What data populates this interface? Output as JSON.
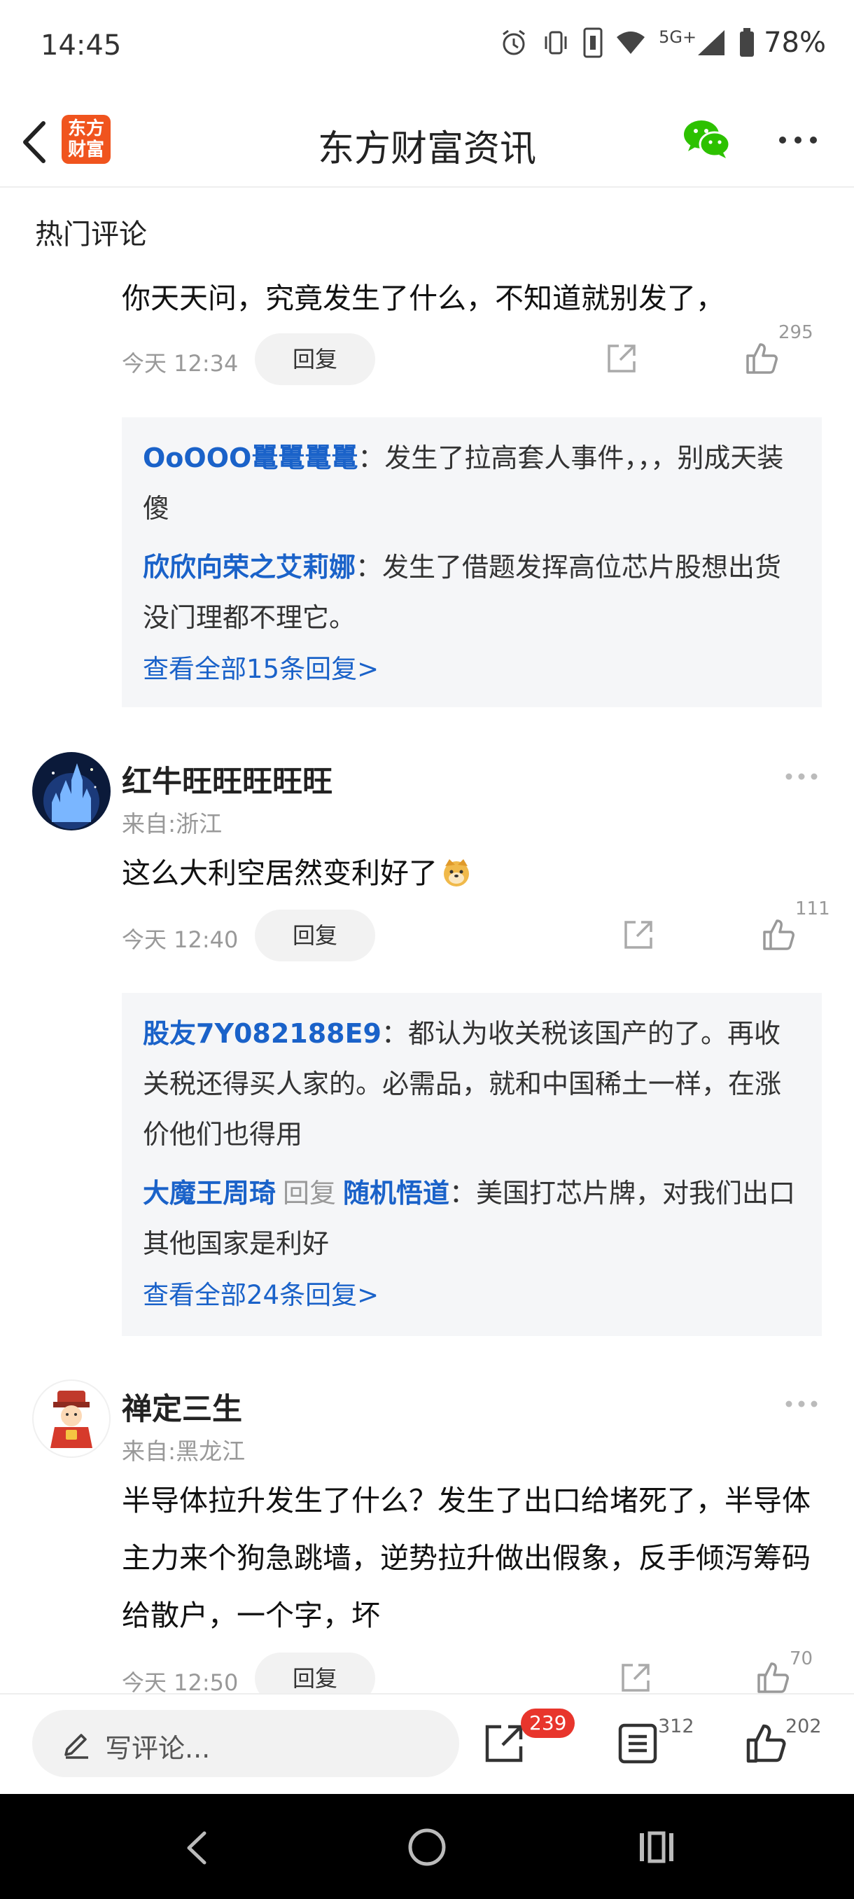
{
  "status_bar": {
    "time": "14:45",
    "network": "5G+",
    "battery": "78%"
  },
  "header": {
    "title": "东方财富资讯",
    "logo_text": "东方财富"
  },
  "section_title": "热门评论",
  "comments": [
    {
      "text": "你天天问，究竟发生了什么，不知道就别发了，",
      "time": "今天 12:34",
      "reply_label": "回复",
      "likes": "295",
      "replies": [
        {
          "user": "OoOOO鼍鼍鼍鼍",
          "text": "：发生了拉高套人事件，，，别成天装傻"
        },
        {
          "user": "欣欣向荣之艾莉娜",
          "text": "：发生了借题发挥高位芯片股想出货没门理都不理它。"
        }
      ],
      "view_all": "查看全部15条回复>"
    },
    {
      "user": "红牛旺旺旺旺旺",
      "location": "来自:浙江",
      "text": "这么大利空居然变利好了",
      "time": "今天 12:40",
      "reply_label": "回复",
      "likes": "111",
      "replies": [
        {
          "user": "股友7Y082188E9",
          "text": "：都认为收关税该国产的了。再收关税还得买人家的。必需品，就和中国稀土一样，在涨价他们也得用"
        },
        {
          "user": "大魔王周琦",
          "verb": "回复",
          "target": "随机悟道",
          "text": "：美国打芯片牌，对我们出口其他国家是利好"
        }
      ],
      "view_all": "查看全部24条回复>"
    },
    {
      "user": "禅定三生",
      "location": "来自:黑龙江",
      "text": "半导体拉升发生了什么？发生了出口给堵死了，半导体主力来个狗急跳墙，逆势拉升做出假象，反手倾泻筹码给散户，一个字，坏",
      "time": "今天 12:50",
      "reply_label": "回复",
      "likes": "70"
    }
  ],
  "bottom_bar": {
    "placeholder": "写评论...",
    "share_badge": "239",
    "comment_count": "312",
    "like_count": "202"
  },
  "colors": {
    "link": "#1a62c9",
    "badge": "#e8352c",
    "logo": "#f0541e"
  }
}
